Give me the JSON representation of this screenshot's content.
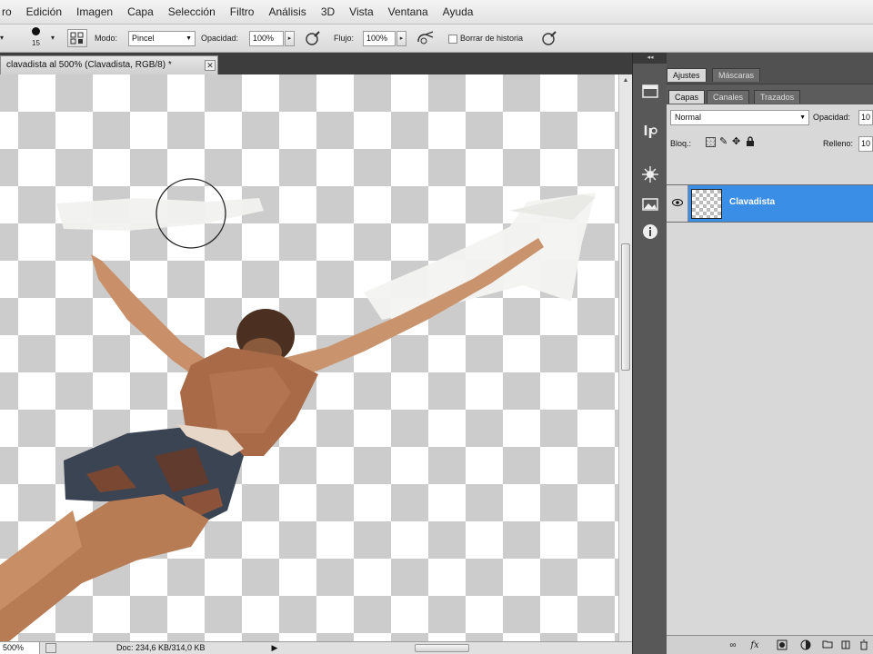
{
  "menu": [
    "ro",
    "Edición",
    "Imagen",
    "Capa",
    "Selección",
    "Filtro",
    "Análisis",
    "3D",
    "Vista",
    "Ventana",
    "Ayuda"
  ],
  "options": {
    "brush_size": "15",
    "mode_label": "Modo:",
    "mode_value": "Pincel",
    "opacity_label": "Opacidad:",
    "opacity_value": "100%",
    "flow_label": "Flujo:",
    "flow_value": "100%",
    "erase_history_label": "Borrar de historia"
  },
  "document": {
    "tab_title": "clavadista al 500% (Clavadista, RGB/8) *",
    "close_glyph": "✕"
  },
  "status": {
    "zoom": "500%",
    "doc_info": "Doc: 234,6 KB/314,0 KB",
    "play_glyph": "▶"
  },
  "panels": {
    "top_tabs": [
      "Ajustes",
      "Máscaras"
    ],
    "layer_tabs": [
      "Capas",
      "Canales",
      "Trazados"
    ],
    "blend_mode": "Normal",
    "opacity_label": "Opacidad:",
    "opacity_value": "10",
    "lock_label": "Bloq.:",
    "fill_label": "Relleno:",
    "fill_value": "10",
    "layer_name": "Clavadista"
  },
  "icons": {
    "dock": [
      "history-icon",
      "brush-presets-icon",
      "navigator-icon",
      "image-icon",
      "info-icon"
    ],
    "footer": [
      "link-icon",
      "fx-icon",
      "mask-icon",
      "adjustment-icon",
      "group-icon",
      "new-layer-icon",
      "trash-icon"
    ]
  },
  "colors": {
    "selected_layer": "#3a8ee6",
    "checker_dark": "#cccccc",
    "checker_light": "#ffffff"
  }
}
